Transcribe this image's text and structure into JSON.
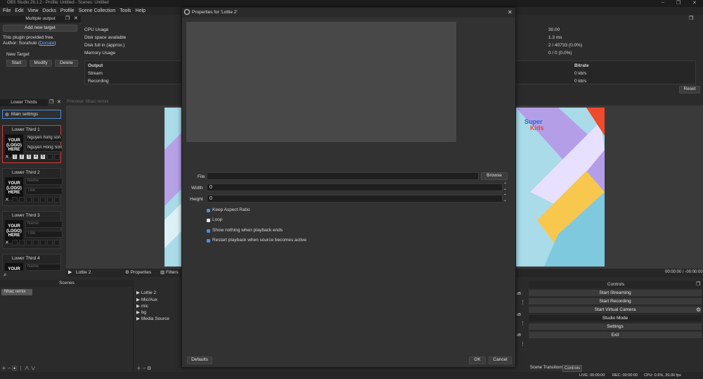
{
  "colors": {
    "accent": "#4f8fd8",
    "dialog_bg": "#323232",
    "panel_bg": "#2b2b2b",
    "selected_red": "#d83a3a"
  },
  "window": {
    "title": "OBS Studio 29.1.2 - Profile: Untitled - Scenes: Untitled"
  },
  "menu": [
    "File",
    "Edit",
    "View",
    "Docks",
    "Profile",
    "Scene Collection",
    "Tools",
    "Help"
  ],
  "multiple_output": {
    "title": "Multiple output",
    "add_button": "Add new target",
    "plugin_line": "This plugin provided free.",
    "author_prefix": "Author: Sorahuki (",
    "author_link": "Donate",
    "author_suffix": ")",
    "target_name": "New Target",
    "start": "Start",
    "modify": "Modify",
    "delete": "Delete"
  },
  "stats": {
    "rows": [
      {
        "label": "CPU Usage",
        "value": "30.00"
      },
      {
        "label": "Disk space available",
        "value": "1.3 ms"
      },
      {
        "label": "Disk full in (approx.)",
        "value": "2 / 40733 (0.0%)"
      },
      {
        "label": "Memory Usage",
        "value": "0 / 0 (0.0%)"
      }
    ],
    "output_header": "Output",
    "bitrate_header": "Bitrate",
    "outputs": [
      {
        "name": "Stream",
        "bitrate": "0 kb/s"
      },
      {
        "name": "Recording",
        "bitrate": "0 kb/s"
      }
    ],
    "reset": "Reset"
  },
  "lower_thirds": {
    "title": "Lower Thirds",
    "main_settings": "Main settings",
    "logo_text": "YOUR\n(LOGO)\nHERE",
    "items": [
      {
        "label": "Lower Third 1",
        "name": "Nguyễn hồng son",
        "title": "Nguyễn Hồng Sơn E"
      },
      {
        "label": "Lower Third 2",
        "name": "Name",
        "title": "Title"
      },
      {
        "label": "Lower Third 3",
        "name": "Name",
        "title": "Title"
      },
      {
        "label": "Lower Third 4",
        "name": "Name",
        "title": ""
      }
    ],
    "numbers": [
      "1",
      "2",
      "3",
      "4",
      "5"
    ],
    "close_glyph": "✕"
  },
  "preview": {
    "label": "Preview: Nhac remix",
    "brand_top": "Super",
    "brand_bottom": "Kids"
  },
  "source_bar": {
    "source_name": "Lottie 2",
    "properties": "Properties",
    "filters": "Filters"
  },
  "timecode": "00:00:00 / -00:00:00",
  "scenes": {
    "title": "Scenes",
    "items": [
      "Nhac remix"
    ]
  },
  "sources": {
    "items": [
      "Lottie 2",
      "Mic/Aux",
      "mic",
      "bg",
      "Media Source"
    ]
  },
  "mixer": {
    "db_label": "dB"
  },
  "controls": {
    "title": "Controls",
    "buttons": [
      "Start Streaming",
      "Start Recording",
      "Start Virtual Camera",
      "Studio Mode",
      "Settings",
      "Exit"
    ],
    "tab_transitions": "Scene Transitions",
    "tab_controls": "Controls"
  },
  "statusbar": {
    "live": "LIVE: 00:00:00",
    "rec": "REC: 00:00:00",
    "cpu": "CPU: 0.6%, 30.00 fps"
  },
  "dialog": {
    "title": "Properties for 'Lottie 2'",
    "file_label": "File",
    "file_value": "",
    "browse": "Browse",
    "width_label": "Width",
    "width_value": "0",
    "height_label": "Height",
    "height_value": "0",
    "checkboxes": [
      {
        "label": "Keep Aspect Ratio",
        "checked": true
      },
      {
        "label": "Loop",
        "checked": false
      },
      {
        "label": "Show nothing when playback ends",
        "checked": true
      },
      {
        "label": "Restart playback when source becomes active",
        "checked": true
      }
    ],
    "defaults": "Defaults",
    "ok": "OK",
    "cancel": "Cancel"
  }
}
